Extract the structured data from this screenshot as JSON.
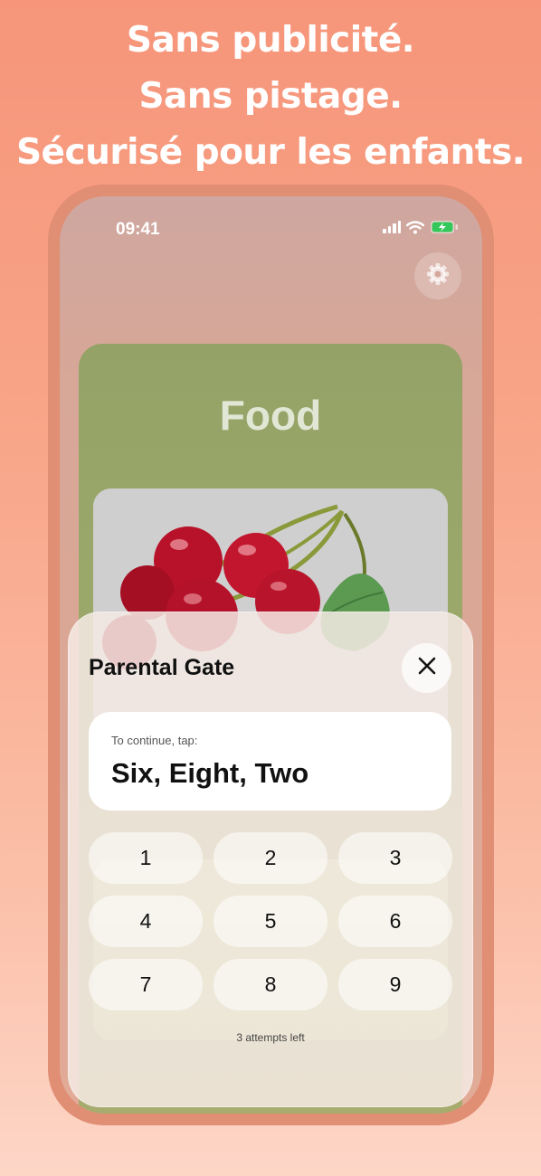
{
  "headline": {
    "line1": "Sans publicité.",
    "line2": "Sans pistage.",
    "line3": "Sécurisé pour les enfants."
  },
  "status_bar": {
    "time": "09:41",
    "battery_color": "#34c759"
  },
  "settings": {
    "icon": "gear-icon"
  },
  "card": {
    "title": "Food"
  },
  "parental_gate": {
    "title": "Parental Gate",
    "close_icon": "close-icon",
    "prompt_label": "To continue, tap:",
    "prompt_value": "Six, Eight, Two",
    "keys": [
      "1",
      "2",
      "3",
      "4",
      "5",
      "6",
      "7",
      "8",
      "9"
    ],
    "attempts": "3 attempts left"
  },
  "colors": {
    "background_top": "#f6957a",
    "background_bottom": "#fdd6c7",
    "phone_frame": "#e08e74"
  }
}
